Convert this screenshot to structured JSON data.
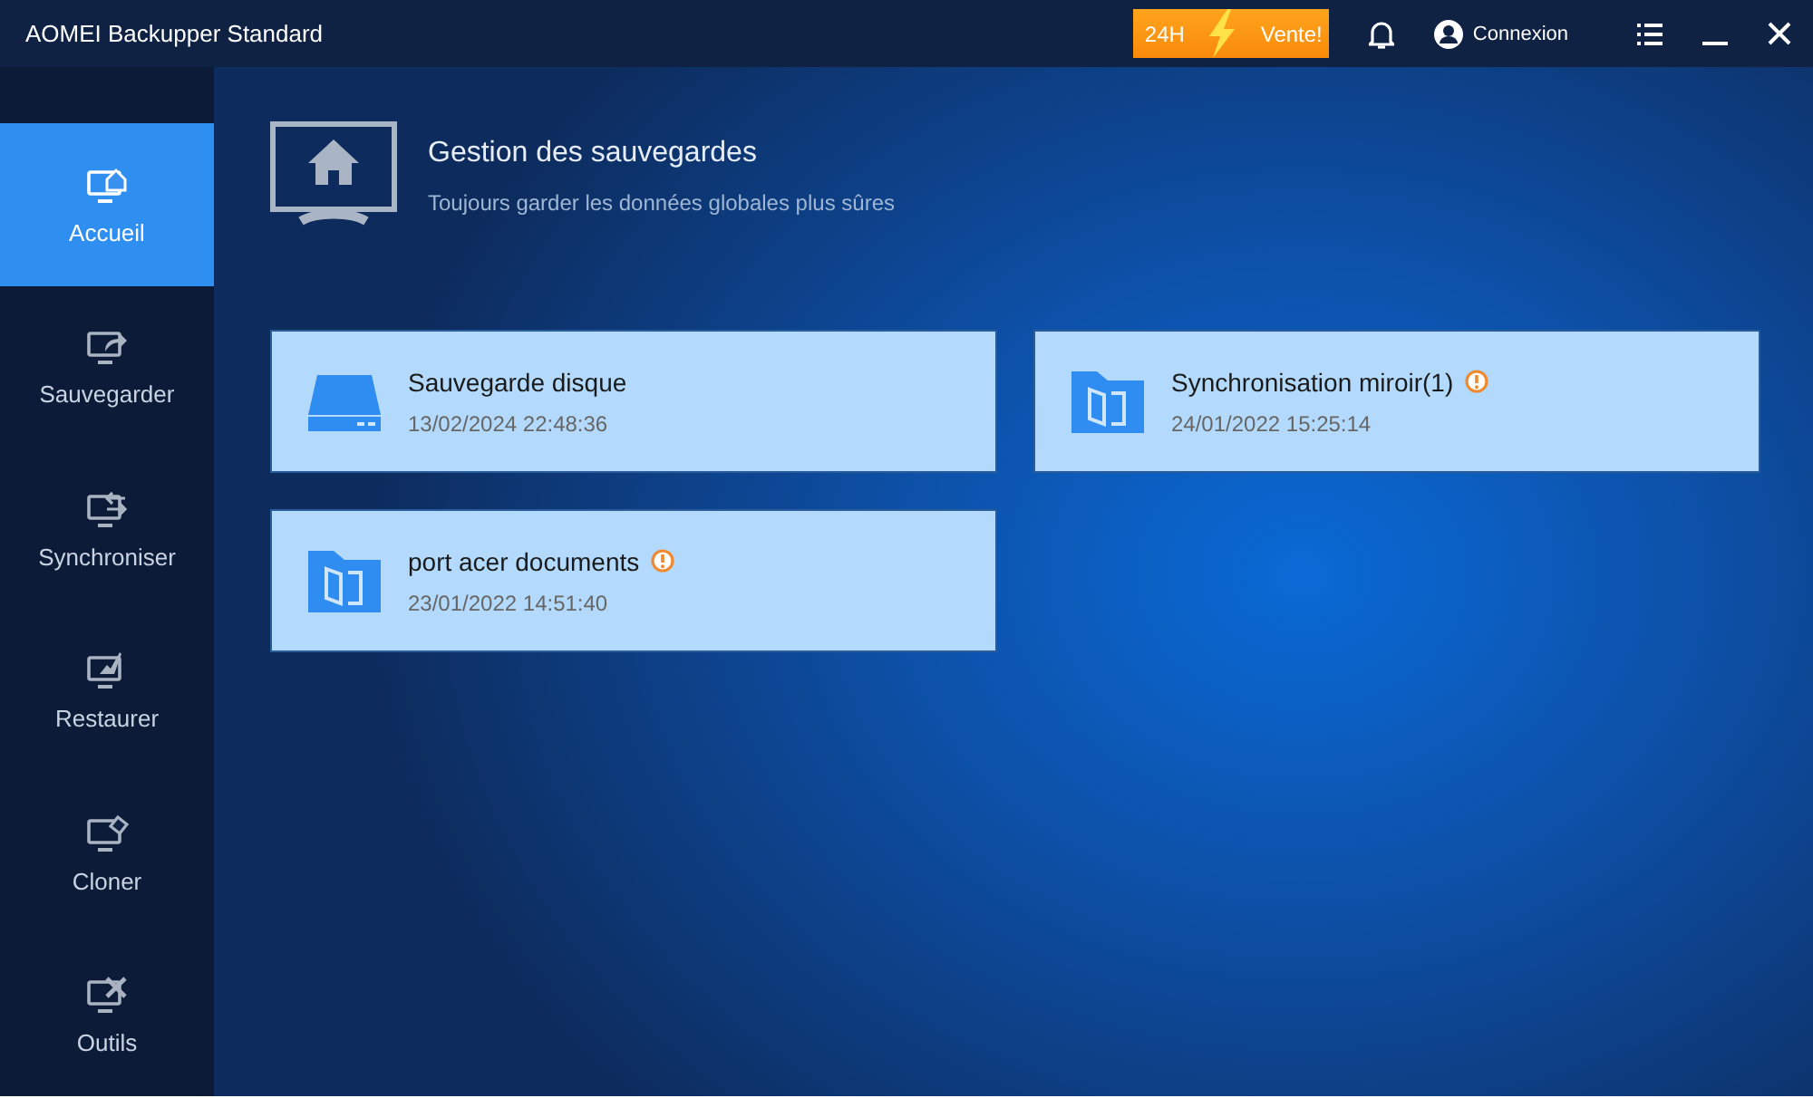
{
  "window": {
    "title": "AOMEI Backupper Standard"
  },
  "promo": {
    "left": "24H",
    "right": "Vente!"
  },
  "account": {
    "label": "Connexion"
  },
  "sidebar": {
    "items": [
      {
        "kind": "home",
        "label": "Accueil",
        "selected": true
      },
      {
        "kind": "backup",
        "label": "Sauvegarder",
        "selected": false
      },
      {
        "kind": "sync",
        "label": "Synchroniser",
        "selected": false
      },
      {
        "kind": "restore",
        "label": "Restaurer",
        "selected": false
      },
      {
        "kind": "clone",
        "label": "Cloner",
        "selected": false
      },
      {
        "kind": "tools",
        "label": "Outils",
        "selected": false
      }
    ]
  },
  "header": {
    "title": "Gestion des sauvegardes",
    "subtitle": "Toujours garder les données globales plus sûres"
  },
  "tasks": [
    {
      "kind": "disk",
      "name": "Sauvegarde disque",
      "time": "13/02/2024 22:48:36",
      "warning": false
    },
    {
      "kind": "sync",
      "name": "Synchronisation miroir(1)",
      "time": "24/01/2022 15:25:14",
      "warning": true
    },
    {
      "kind": "sync",
      "name": "port acer documents",
      "time": "23/01/2022 14:51:40",
      "warning": true
    }
  ]
}
